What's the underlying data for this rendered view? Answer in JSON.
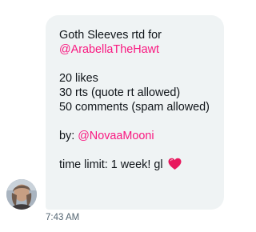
{
  "message": {
    "line1": "Goth Sleeves rtd for",
    "mention1": "@ArabellaTheHawt",
    "requirement1": "20 likes",
    "requirement2": "30 rts (quote rt allowed)",
    "requirement3": "50 comments (spam allowed)",
    "by_prefix": "by: ",
    "mention2": "@NovaaMooni",
    "time_limit": "time limit: 1 week! gl"
  },
  "timestamp": "7:43 AM",
  "colors": {
    "bubble_background": "#eff3f4",
    "text": "#0f1419",
    "mention": "#f91880",
    "timestamp": "#536471",
    "heart": "#e8175d"
  },
  "icons": {
    "heart": "pink-heart-emoji",
    "avatar": "user-avatar"
  }
}
